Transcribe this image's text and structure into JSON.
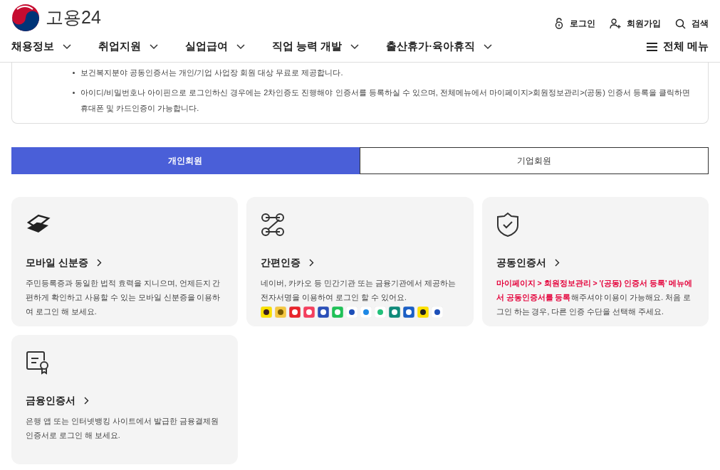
{
  "header": {
    "logo_text": "고용24",
    "utility_links": [
      {
        "kind": "login",
        "label": "로그인"
      },
      {
        "kind": "signup",
        "label": "회원가입"
      },
      {
        "kind": "search",
        "label": "검색"
      }
    ]
  },
  "nav": {
    "items": [
      "채용정보",
      "취업지원",
      "실업급여",
      "직업 능력 개발",
      "출산휴가·육아휴직"
    ],
    "all_menu": "전체 메뉴"
  },
  "notice": {
    "items": [
      "보건복지분야 공동인증서는 개인/기업 사업장 회원 대상 무료로 제공합니다.",
      "아이디/비밀번호나 아이핀으로 로그인하신 경우에는 2차인증도 진행해야 인증서를 등록하실 수 있으며, 전체메뉴에서 마이페이지>회원정보관리>(공동) 인증서 등록을 클릭하면 휴대폰 및 카드인증이 가능합니다."
    ]
  },
  "tabs": [
    {
      "label": "개인회원",
      "selected": true
    },
    {
      "label": "기업회원",
      "selected": false
    }
  ],
  "cards": [
    {
      "kind": "mobile_id",
      "title": "모바일 신분증",
      "description": "주민등록증과 동일한 법적 효력을 지니으며, 언제든지 간편하게 확인하고 사용할 수 있는 모바일 신분증을 이용하여 로그인 해 보세요."
    },
    {
      "kind": "simple_auth",
      "title": "간편인증",
      "description": "네이버, 카카오 등 민간기관 또는 금융기관에서 제공하는 전자서명을 이용하여 로그인 할 수 있어요."
    },
    {
      "kind": "joint_cert",
      "title": "공동인증서",
      "description": "**마이페이지 > 회원정보관리 > '(공동) 인증서 등록' 메뉴에서 공동인증서를 등록**해주셔야 이용이 가능해요. 처음 로그인 하는 경우, 다른 인증 수단을 선택해 주세요."
    },
    {
      "kind": "finance_cert",
      "title": "금융인증서",
      "description": "은행 앱 또는 인터넷뱅킹 사이트에서 발급한 금융결제원 인증서로 로그인 해 보세요."
    }
  ]
}
